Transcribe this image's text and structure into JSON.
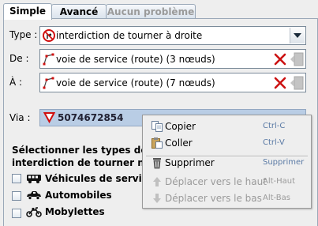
{
  "tabs": [
    {
      "label": "Simple",
      "state": "active"
    },
    {
      "label": "Avancé",
      "state": "normal"
    },
    {
      "label": "Aucun problème",
      "state": "disabled"
    }
  ],
  "type_row": {
    "label": "Type :",
    "value": "interdiction de tourner à droite",
    "icon": "no-right-turn-sign-icon"
  },
  "from_row": {
    "label": "De :",
    "value": "voie de service (route) (3 nœuds)",
    "icon": "way-icon"
  },
  "to_row": {
    "label": "À :",
    "value": "voie de service (route) (7 nœuds)",
    "icon": "way-icon"
  },
  "via_row": {
    "label": "Via :",
    "value": "5074672854",
    "icon": "node-triangle-icon"
  },
  "vehicles": {
    "heading_line1": "Sélectionner les types de véhi",
    "heading_line2": "interdiction de tourner ne s'ap",
    "items": [
      {
        "label": "Véhicules de service p",
        "icon": "bus-icon",
        "checked": false
      },
      {
        "label": "Automobiles",
        "icon": "car-icon",
        "checked": false
      },
      {
        "label": "Mobylettes",
        "icon": "moped-icon",
        "checked": false
      }
    ]
  },
  "context_menu": {
    "items": [
      {
        "label": "Copier",
        "accel": "Ctrl-C",
        "icon": "copy-icon",
        "enabled": true
      },
      {
        "label": "Coller",
        "accel": "Ctrl-V",
        "icon": "paste-icon",
        "enabled": true
      },
      {
        "label": "Supprimer",
        "accel": "Supprimer",
        "icon": "trash-icon",
        "enabled": true
      },
      {
        "label": "Déplacer vers le haut",
        "accel": "Alt-Haut",
        "icon": "arrow-up-icon",
        "enabled": false
      },
      {
        "label": "Déplacer vers le bas",
        "accel": "Alt-Bas",
        "icon": "arrow-down-icon",
        "enabled": false
      }
    ]
  },
  "colors": {
    "selection": "#b9cde5",
    "accelerator": "#5a7aa5",
    "remove_red": "#cc1111",
    "sign_red": "#d01010"
  }
}
